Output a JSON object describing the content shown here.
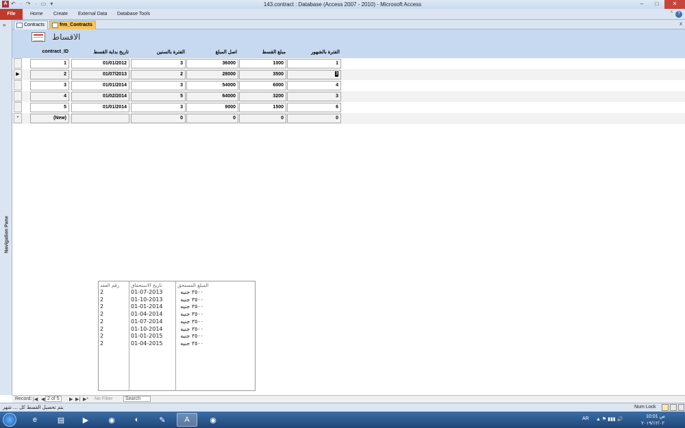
{
  "window": {
    "title": "143.contract : Database (Access 2007 - 2010) - Microsoft Access",
    "app_icon": "A",
    "qat": "↶ · ↷ · ▭ ▾",
    "min": "–",
    "max": "□",
    "close": "✕"
  },
  "ribbon": {
    "file": "File",
    "tabs": [
      "Home",
      "Create",
      "External Data",
      "Database Tools"
    ],
    "help": "?",
    "collapse": "^"
  },
  "nav_pane": {
    "toggle": "»",
    "label": "Navigation Pane"
  },
  "doc_tabs": {
    "tabs": [
      "Contracts",
      "frm_Contracts"
    ],
    "close": "x"
  },
  "form": {
    "title": "الاقساط",
    "headers": {
      "contract_id": "contract_ID",
      "start_date": "تاريخ بداية القسط",
      "years": "الفترة بالسنين",
      "principal": "اصل المبلغ",
      "installment": "مبلغ القسط",
      "months": "الفترة بالشهور"
    },
    "rows": [
      {
        "selector": "",
        "contract_id": "1",
        "start_date": "01/01/2012",
        "years": "3",
        "principal": "36000",
        "installment": "1000",
        "months": "1"
      },
      {
        "selector": "▶",
        "contract_id": "2",
        "start_date": "01/07/2013",
        "years": "2",
        "principal": "28000",
        "installment": "3500",
        "months": "3"
      },
      {
        "selector": "",
        "contract_id": "3",
        "start_date": "01/01/2014",
        "years": "3",
        "principal": "54000",
        "installment": "6000",
        "months": "4"
      },
      {
        "selector": "",
        "contract_id": "4",
        "start_date": "01/02/2014",
        "years": "5",
        "principal": "64000",
        "installment": "3200",
        "months": "3"
      },
      {
        "selector": "",
        "contract_id": "5",
        "start_date": "01/01/2014",
        "years": "3",
        "principal": "9000",
        "installment": "1500",
        "months": "6"
      },
      {
        "selector": "*",
        "contract_id": "(New)",
        "start_date": "",
        "years": "0",
        "principal": "0",
        "installment": "0",
        "months": "0"
      }
    ]
  },
  "sublist": {
    "headers": {
      "contract_no": "رقم العقد",
      "due_date": "تاريخ الاستحقاق",
      "amount": "المبلغ المستحق"
    },
    "contract_no": "2\n2\n2\n2\n2\n2\n2\n2",
    "due_dates": "01-07-2013\n01-10-2013\n01-01-2014\n01-04-2014\n01-07-2014\n01-10-2014\n01-01-2015\n01-04-2015",
    "amounts": "٣٥٠٠ جنيه\n٣٥٠٠ جنيه\n٣٥٠٠ جنيه\n٣٥٠٠ جنيه\n٣٥٠٠ جنيه\n٣٥٠٠ جنيه\n٣٥٠٠ جنيه\n٣٥٠٠ جنيه"
  },
  "record_nav": {
    "label": "Record:",
    "first": "|◀",
    "prev": "◀",
    "current": "2 of 5",
    "next": "▶",
    "last": "▶|",
    "new": "▶*",
    "filter": "No Filter",
    "search": "Search"
  },
  "statusbar": {
    "message": "يتم تحصيل القسط كل ... شهر",
    "numlock": "Num Lock"
  },
  "taskbar": {
    "lang": "AR",
    "time": "10:01 ص",
    "date": "٢٠١٩/١٢/٠٢",
    "tray_icons": "▲  ⚑  ▮▮▮  🔊"
  }
}
